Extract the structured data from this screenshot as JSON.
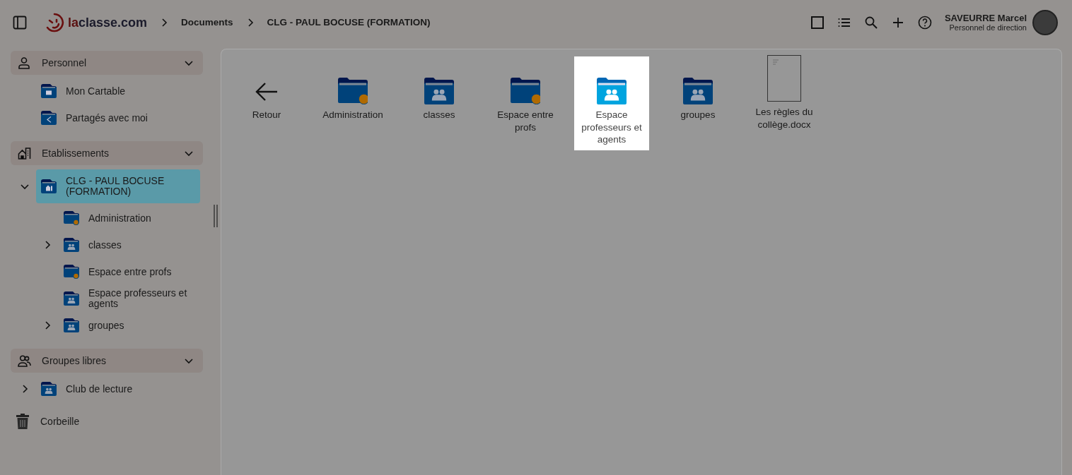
{
  "topbar": {
    "logo_prefix": "la",
    "logo_suffix": "classe.com",
    "breadcrumb": [
      "Documents",
      "CLG - PAUL BOCUSE (FORMATION)"
    ],
    "user": {
      "name": "SAVEURRE Marcel",
      "role": "Personnel de direction"
    }
  },
  "sidebar": {
    "sections": [
      {
        "title": "Personnel",
        "kind": "person",
        "expanded": true,
        "items": [
          {
            "label": "Mon Cartable",
            "kind": "briefcase",
            "selected": false
          },
          {
            "label": "Partagés avec moi",
            "kind": "share",
            "selected": false
          }
        ]
      },
      {
        "title": "Etablissements",
        "kind": "building",
        "expanded": true,
        "items": [
          {
            "label": "CLG - PAUL BOCUSE (FORMATION)",
            "kind": "school",
            "selected": true,
            "expanded": true,
            "children": [
              {
                "label": "Administration",
                "kind": "dot",
                "selected": false
              },
              {
                "label": "classes",
                "kind": "group",
                "selected": false,
                "expanded": false
              },
              {
                "label": "Espace entre profs",
                "kind": "dot",
                "selected": false
              },
              {
                "label": "Espace professeurs et agents",
                "kind": "group",
                "selected": false
              },
              {
                "label": "groupes",
                "kind": "group",
                "selected": false,
                "expanded": false
              }
            ]
          }
        ]
      },
      {
        "title": "Groupes libres",
        "kind": "people",
        "expanded": true,
        "items": [
          {
            "label": "Club de lecture",
            "kind": "group",
            "selected": false,
            "expanded": false
          }
        ]
      }
    ],
    "trash": {
      "label": "Corbeille"
    }
  },
  "files": [
    {
      "label": "Retour",
      "kind": "back",
      "selected": false
    },
    {
      "label": "Administration",
      "kind": "folder-dot",
      "selected": false
    },
    {
      "label": "classes",
      "kind": "folder-group",
      "selected": false
    },
    {
      "label": "Espace entre profs",
      "kind": "folder-dot",
      "selected": false
    },
    {
      "label": "Espace professeurs et agents",
      "kind": "folder-group",
      "selected": true
    },
    {
      "label": "groupes",
      "kind": "folder-group",
      "selected": false
    },
    {
      "label": "Les règles du collège.docx",
      "kind": "document",
      "selected": false
    }
  ]
}
